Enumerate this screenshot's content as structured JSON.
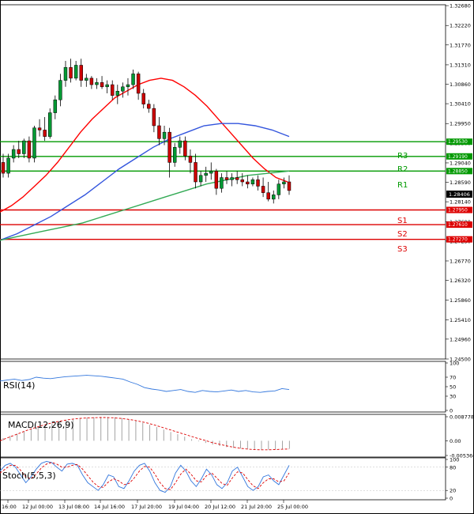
{
  "chart_data": {
    "type": "candlestick",
    "instrument_timeframe": "",
    "price_axis": {
      "ticks": [
        "1.32680",
        "1.32220",
        "1.31770",
        "1.31310",
        "1.30860",
        "1.30410",
        "1.29950",
        "1.29500",
        "1.29040",
        "1.28590",
        "1.28140",
        "1.27680",
        "1.27230",
        "1.26770",
        "1.26320",
        "1.25860",
        "1.25410",
        "1.24960",
        "1.24500"
      ],
      "range": [
        1.245,
        1.327
      ]
    },
    "time_axis": {
      "labels": [
        "16:00",
        "12 Jul 00:00",
        "13 Jul 08:00",
        "14 Jul 16:00",
        "17 Jul 20:00",
        "19 Jul 04:00",
        "20 Jul 12:00",
        "21 Jul 20:00",
        "25 Jul 00:00"
      ],
      "bars": 60
    },
    "current_price": "1.28406",
    "levels": [
      {
        "name": "R3",
        "value": 1.2953,
        "label": "1.29530",
        "type": "resistance",
        "color": "#009900"
      },
      {
        "name": "R2",
        "value": 1.2919,
        "label": "1.29190",
        "type": "resistance",
        "color": "#009900"
      },
      {
        "name": "R1",
        "value": 1.2885,
        "label": "1.28850",
        "type": "resistance",
        "color": "#009900"
      },
      {
        "name": "S1",
        "value": 1.2795,
        "label": "1.27950",
        "type": "support",
        "color": "#dd0000"
      },
      {
        "name": "S2",
        "value": 1.2761,
        "label": "1.27610",
        "type": "support",
        "color": "#dd0000"
      },
      {
        "name": "S3",
        "value": 1.2727,
        "label": "1.27270",
        "type": "support",
        "color": "#dd0000"
      }
    ],
    "candles": [
      [
        1.2905,
        1.2925,
        1.287,
        1.288
      ],
      [
        1.288,
        1.2925,
        1.287,
        1.2915
      ],
      [
        1.2915,
        1.2945,
        1.2905,
        1.2935
      ],
      [
        1.2935,
        1.2955,
        1.2915,
        1.2925
      ],
      [
        1.2925,
        1.296,
        1.2915,
        1.2955
      ],
      [
        1.2955,
        1.2965,
        1.2905,
        1.2915
      ],
      [
        1.2915,
        1.299,
        1.2905,
        1.2985
      ],
      [
        1.2985,
        1.3005,
        1.2965,
        1.298
      ],
      [
        1.298,
        1.301,
        1.2955,
        1.2965
      ],
      [
        1.2965,
        1.303,
        1.296,
        1.302
      ],
      [
        1.302,
        1.306,
        1.3005,
        1.305
      ],
      [
        1.305,
        1.311,
        1.3035,
        1.3095
      ],
      [
        1.3095,
        1.314,
        1.308,
        1.3125
      ],
      [
        1.3125,
        1.3145,
        1.309,
        1.31
      ],
      [
        1.31,
        1.314,
        1.3095,
        1.313
      ],
      [
        1.313,
        1.3145,
        1.308,
        1.3095
      ],
      [
        1.3095,
        1.311,
        1.308,
        1.31
      ],
      [
        1.31,
        1.3105,
        1.3075,
        1.3085
      ],
      [
        1.3085,
        1.31,
        1.3075,
        1.309
      ],
      [
        1.309,
        1.3105,
        1.3075,
        1.308
      ],
      [
        1.308,
        1.3095,
        1.3065,
        1.3085
      ],
      [
        1.3085,
        1.3095,
        1.305,
        1.306
      ],
      [
        1.306,
        1.3085,
        1.304,
        1.307
      ],
      [
        1.307,
        1.309,
        1.3055,
        1.308
      ],
      [
        1.308,
        1.31,
        1.306,
        1.3085
      ],
      [
        1.3085,
        1.312,
        1.3075,
        1.311
      ],
      [
        1.311,
        1.3115,
        1.305,
        1.3065
      ],
      [
        1.3065,
        1.3075,
        1.303,
        1.304
      ],
      [
        1.304,
        1.305,
        1.302,
        1.303
      ],
      [
        1.303,
        1.304,
        1.2975,
        1.299
      ],
      [
        1.299,
        1.301,
        1.2945,
        1.296
      ],
      [
        1.296,
        1.299,
        1.2945,
        1.2975
      ],
      [
        1.2975,
        1.2985,
        1.287,
        1.2905
      ],
      [
        1.2905,
        1.295,
        1.2895,
        1.294
      ],
      [
        1.294,
        1.2965,
        1.2925,
        1.2955
      ],
      [
        1.2955,
        1.2965,
        1.291,
        1.292
      ],
      [
        1.292,
        1.2935,
        1.288,
        1.2905
      ],
      [
        1.2905,
        1.2925,
        1.2845,
        1.286
      ],
      [
        1.286,
        1.2885,
        1.285,
        1.2875
      ],
      [
        1.2875,
        1.2895,
        1.286,
        1.288
      ],
      [
        1.288,
        1.2905,
        1.2865,
        1.2885
      ],
      [
        1.2885,
        1.289,
        1.283,
        1.2845
      ],
      [
        1.2845,
        1.288,
        1.2835,
        1.287
      ],
      [
        1.287,
        1.2885,
        1.2855,
        1.2865
      ],
      [
        1.2865,
        1.288,
        1.285,
        1.287
      ],
      [
        1.287,
        1.2885,
        1.2855,
        1.2865
      ],
      [
        1.2865,
        1.288,
        1.285,
        1.286
      ],
      [
        1.286,
        1.2875,
        1.2845,
        1.2855
      ],
      [
        1.2855,
        1.287,
        1.285,
        1.2865
      ],
      [
        1.2865,
        1.2875,
        1.284,
        1.285
      ],
      [
        1.285,
        1.287,
        1.2825,
        1.2835
      ],
      [
        1.2835,
        1.286,
        1.2815,
        1.282
      ],
      [
        1.282,
        1.284,
        1.281,
        1.283
      ],
      [
        1.283,
        1.2865,
        1.282,
        1.2855
      ],
      [
        1.2855,
        1.287,
        1.2845,
        1.286
      ],
      [
        1.286,
        1.2875,
        1.283,
        1.284
      ]
    ],
    "moving_averages": [
      {
        "color": "#ff0000",
        "values": [
          1.279,
          1.2805,
          1.2825,
          1.285,
          1.2875,
          1.2905,
          1.294,
          1.2975,
          1.3005,
          1.303,
          1.3055,
          1.307,
          1.3085,
          1.3095,
          1.31,
          1.3095,
          1.308,
          1.306,
          1.3035,
          1.3005,
          1.2975,
          1.2945,
          1.2915,
          1.289,
          1.287,
          1.286
        ]
      },
      {
        "color": "#3355dd",
        "values": [
          1.2725,
          1.274,
          1.276,
          1.278,
          1.2805,
          1.283,
          1.286,
          1.289,
          1.2915,
          1.294,
          1.296,
          1.2975,
          1.299,
          1.2995,
          1.2995,
          1.299,
          1.298,
          1.2965
        ]
      },
      {
        "color": "#33aa55",
        "values": [
          1.2725,
          1.2735,
          1.2745,
          1.2755,
          1.2765,
          1.278,
          1.2795,
          1.281,
          1.2825,
          1.284,
          1.2855,
          1.2865,
          1.2875,
          1.288,
          1.2885
        ]
      }
    ],
    "rsi": {
      "label": "RSI(14)",
      "ticks": [
        "100",
        "70",
        "50",
        "30",
        "0"
      ],
      "values": [
        62,
        64,
        66,
        63,
        65,
        70,
        68,
        67,
        69,
        71,
        72,
        73,
        74,
        73,
        72,
        70,
        68,
        66,
        60,
        55,
        48,
        45,
        43,
        40,
        42,
        44,
        40,
        38,
        42,
        40,
        39,
        41,
        43,
        40,
        42,
        39,
        38,
        40,
        41,
        46,
        44
      ]
    },
    "macd": {
      "label": "MACD(12,26,9)",
      "ticks": [
        "0.008778",
        "0.00",
        "-0.005366"
      ],
      "histogram": [
        0.001,
        0.0018,
        0.0026,
        0.0034,
        0.0042,
        0.005,
        0.0058,
        0.0064,
        0.007,
        0.0075,
        0.0079,
        0.0082,
        0.0084,
        0.0086,
        0.0087,
        0.0087,
        0.0086,
        0.0083,
        0.0079,
        0.0073,
        0.0066,
        0.0058,
        0.005,
        0.0041,
        0.0032,
        0.0024,
        0.0015,
        0.0006,
        -0.0002,
        -0.0008,
        -0.0014,
        -0.0019,
        -0.0023,
        -0.0026,
        -0.0028,
        -0.003,
        -0.0031,
        -0.0032,
        -0.0032,
        -0.0031,
        -0.003,
        -0.0029
      ],
      "signal": [
        0.0,
        0.001,
        0.002,
        0.003,
        0.004,
        0.0048,
        0.0056,
        0.0063,
        0.0069,
        0.0074,
        0.0078,
        0.0081,
        0.0083,
        0.0084,
        0.0085,
        0.0085,
        0.0084,
        0.0082,
        0.0079,
        0.0075,
        0.007,
        0.0064,
        0.0057,
        0.0049,
        0.0041,
        0.0033,
        0.0025,
        0.0017,
        0.0009,
        0.0002,
        -0.0006,
        -0.0012,
        -0.0018,
        -0.0023,
        -0.0027,
        -0.003,
        -0.0032,
        -0.0033,
        -0.0033,
        -0.0032,
        -0.0031,
        -0.003
      ]
    },
    "stoch": {
      "label": "Stoch(5,5,3)",
      "ticks": [
        "100",
        "80",
        "20",
        "0"
      ],
      "k": [
        70,
        85,
        90,
        80,
        60,
        40,
        55,
        75,
        90,
        95,
        92,
        80,
        70,
        88,
        90,
        85,
        60,
        40,
        30,
        20,
        35,
        60,
        55,
        30,
        25,
        45,
        70,
        85,
        90,
        70,
        40,
        20,
        15,
        30,
        65,
        85,
        70,
        45,
        30,
        50,
        75,
        60,
        35,
        25,
        40,
        70,
        80,
        55,
        30,
        20,
        30,
        55,
        60,
        45,
        35,
        60,
        85
      ],
      "d": [
        65,
        75,
        85,
        85,
        72,
        55,
        50,
        62,
        78,
        88,
        92,
        88,
        80,
        80,
        85,
        87,
        75,
        58,
        42,
        30,
        28,
        42,
        50,
        45,
        35,
        38,
        52,
        70,
        82,
        80,
        62,
        40,
        25,
        22,
        40,
        62,
        75,
        62,
        45,
        42,
        58,
        65,
        52,
        38,
        33,
        52,
        68,
        65,
        48,
        32,
        25,
        40,
        50,
        50,
        42,
        45,
        65
      ]
    }
  },
  "labels": {
    "r3": "R3",
    "r2": "R2",
    "r1": "R1",
    "s1": "S1",
    "s2": "S2",
    "s3": "S3",
    "rsi": "RSI(14)",
    "macd": "MACD(12,26,9)",
    "stoch": "Stoch(5,5,3)"
  }
}
